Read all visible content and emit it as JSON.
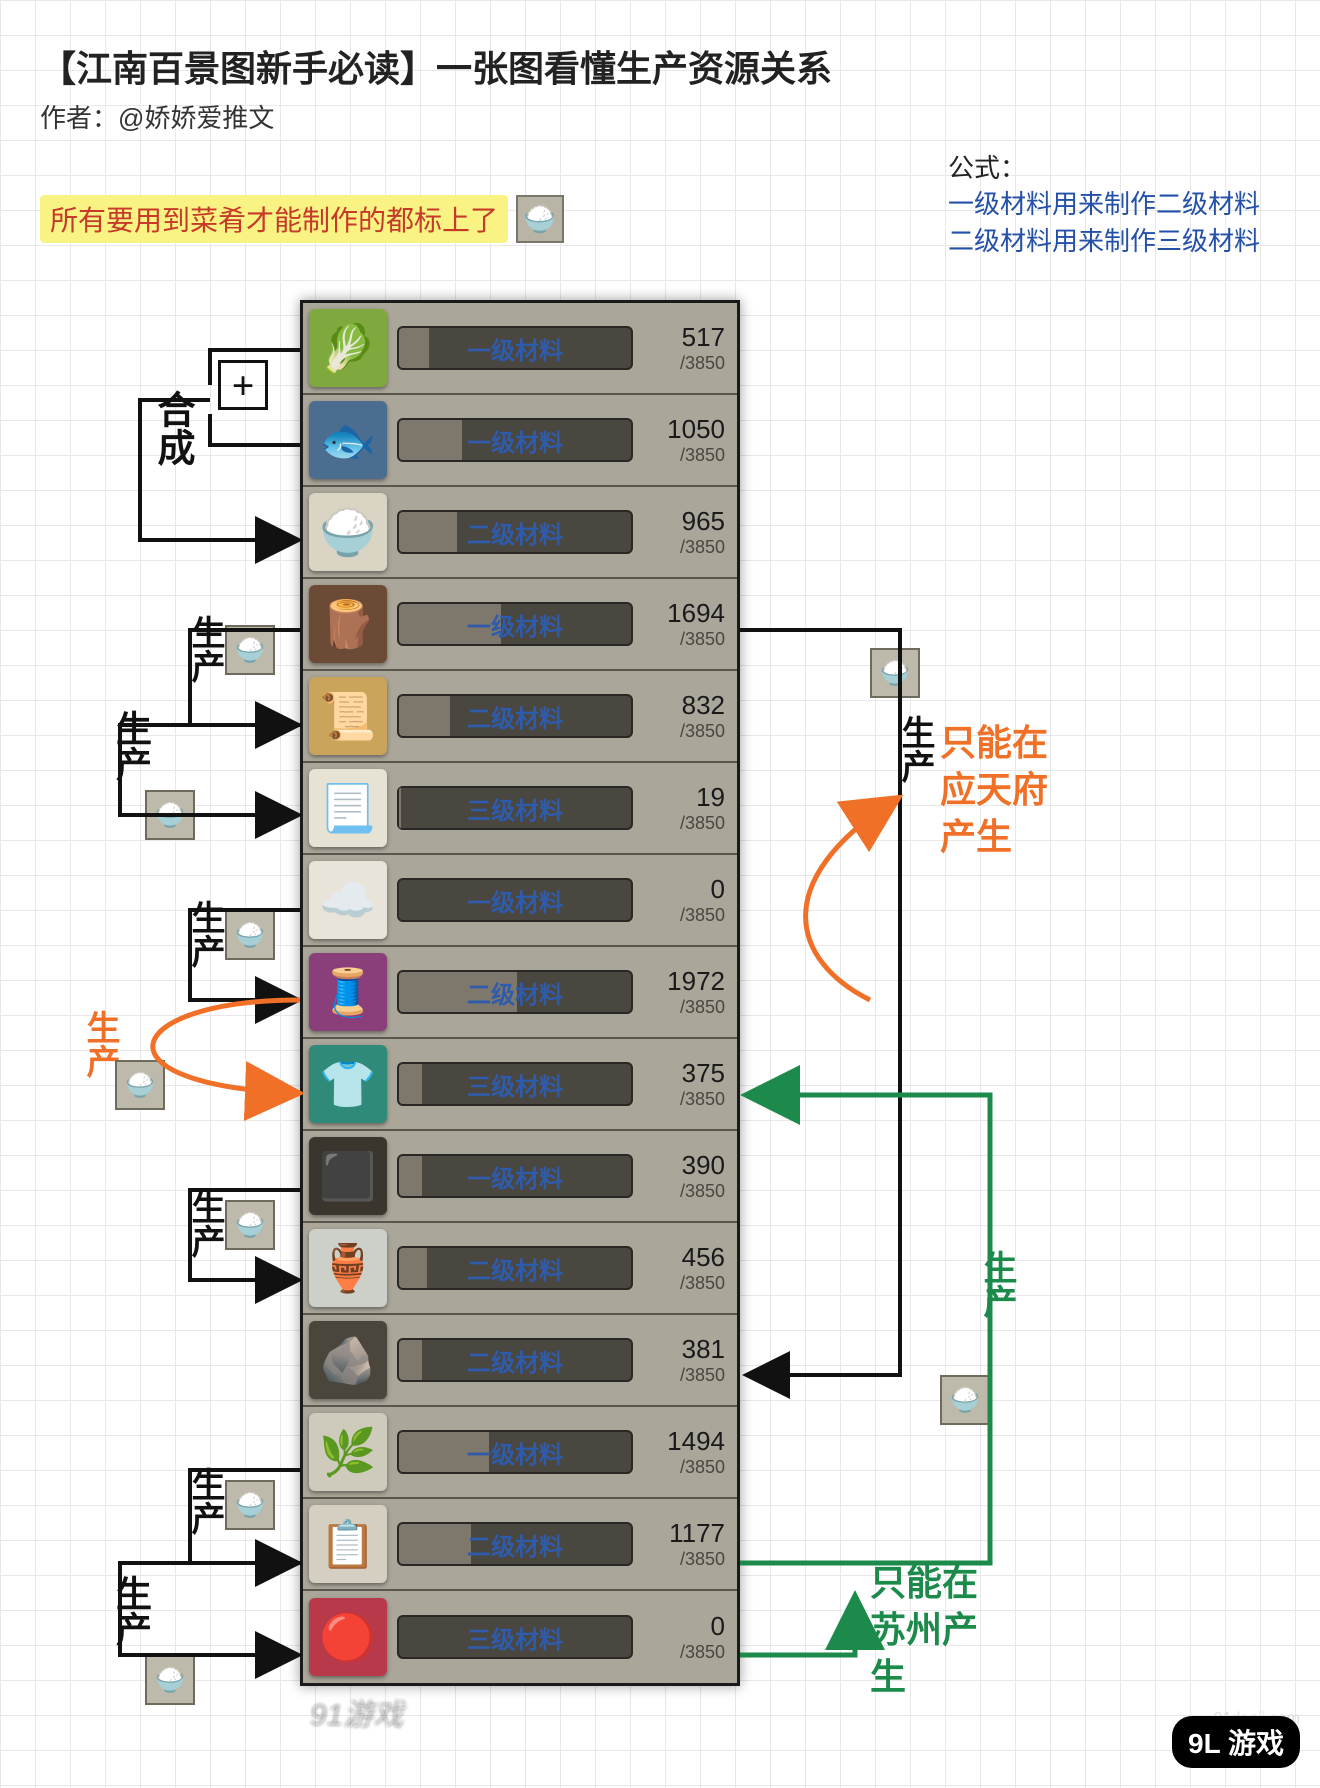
{
  "header": {
    "title": "【江南百景图新手必读】一张图看懂生产资源关系",
    "author": "作者：@娇娇爱推文"
  },
  "note": {
    "text": "所有要用到菜肴才能制作的都标上了",
    "icon_glyph": "🍚"
  },
  "formula": {
    "title": "公式：",
    "line1": "一级材料用来制作二级材料",
    "line2": "二级材料用来制作三级材料"
  },
  "max_capacity": "/3850",
  "resources": [
    {
      "name": "蔬菜",
      "icon": "🥬",
      "color": "#7fa83f",
      "level": "一级材料",
      "current": "517",
      "pct": 13
    },
    {
      "name": "鱼肉",
      "icon": "🐟",
      "color": "#4b6d8f",
      "level": "一级材料",
      "current": "1050",
      "pct": 27
    },
    {
      "name": "菜肴",
      "icon": "🍚",
      "color": "#d9d4c4",
      "level": "二级材料",
      "current": "965",
      "pct": 25
    },
    {
      "name": "原木",
      "icon": "🪵",
      "color": "#6b4b35",
      "level": "一级材料",
      "current": "1694",
      "pct": 44
    },
    {
      "name": "木板",
      "icon": "📜",
      "color": "#c9a45a",
      "level": "二级材料",
      "current": "832",
      "pct": 22
    },
    {
      "name": "图纸",
      "icon": "📃",
      "color": "#e6e2d4",
      "level": "三级材料",
      "current": "19",
      "pct": 1
    },
    {
      "name": "棉花",
      "icon": "☁️",
      "color": "#e8e4da",
      "level": "一级材料",
      "current": "0",
      "pct": 0
    },
    {
      "name": "布匹",
      "icon": "🧵",
      "color": "#8b3f7a",
      "level": "二级材料",
      "current": "1972",
      "pct": 51
    },
    {
      "name": "成衣",
      "icon": "👕",
      "color": "#2f8a7a",
      "level": "三级材料",
      "current": "375",
      "pct": 10
    },
    {
      "name": "原矿",
      "icon": "⬛",
      "color": "#3a362e",
      "level": "一级材料",
      "current": "390",
      "pct": 10
    },
    {
      "name": "瓷器",
      "icon": "🏺",
      "color": "#cdd0c8",
      "level": "二级材料",
      "current": "456",
      "pct": 12
    },
    {
      "name": "炭",
      "icon": "🪨",
      "color": "#4a463c",
      "level": "二级材料",
      "current": "381",
      "pct": 10
    },
    {
      "name": "草药",
      "icon": "🌿",
      "color": "#cfcbbc",
      "level": "一级材料",
      "current": "1494",
      "pct": 39
    },
    {
      "name": "膏药",
      "icon": "📋",
      "color": "#d4cfc0",
      "level": "二级材料",
      "current": "1177",
      "pct": 31
    },
    {
      "name": "丹丸",
      "icon": "🔴",
      "color": "#b83a4a",
      "level": "三级材料",
      "current": "0",
      "pct": 0
    }
  ],
  "annotations": {
    "hecheng": "合成",
    "shengchan": "生产",
    "plus": "+",
    "ying_tian": "只能在应天府产生",
    "su_zhou": "只能在苏州产生",
    "dish_glyph": "🍚"
  },
  "watermarks": {
    "logo": "9L 游戏",
    "url": "91danji.com",
    "small": "91游戏"
  }
}
